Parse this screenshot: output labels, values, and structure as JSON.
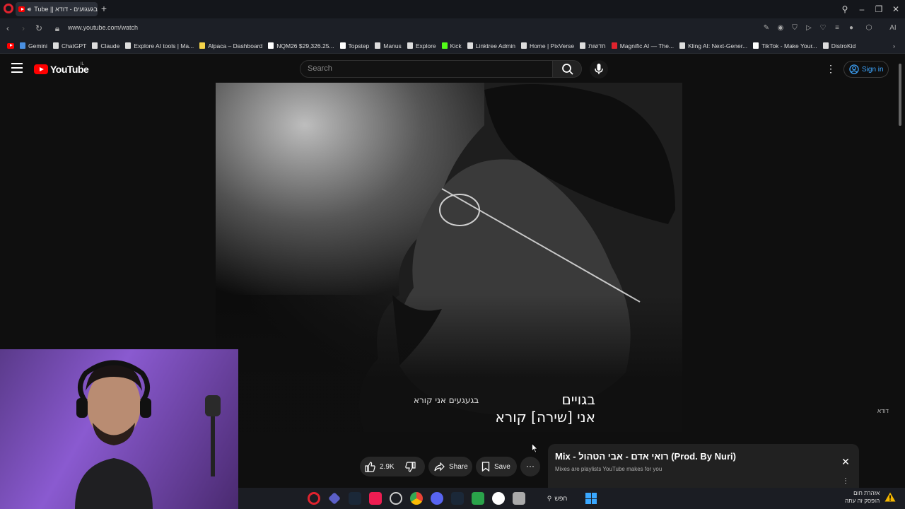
{
  "browser": {
    "tab_title": "Tube || בגעגועים - דודא",
    "url": "www.youtube.com/watch",
    "bookmarks": [
      {
        "label": "Gemini",
        "color": "#4a90e2"
      },
      {
        "label": "ChatGPT",
        "color": "#dddddd"
      },
      {
        "label": "Claude",
        "color": "#dddddd"
      },
      {
        "label": "Explore AI tools | Ma...",
        "color": "#dddddd"
      },
      {
        "label": "Alpaca – Dashboard",
        "color": "#f5d44a"
      },
      {
        "label": "NQM26 $29,326.25...",
        "color": "#ffffff"
      },
      {
        "label": "Topstep",
        "color": "#ffffff"
      },
      {
        "label": "Manus",
        "color": "#dddddd"
      },
      {
        "label": "Explore",
        "color": "#dddddd"
      },
      {
        "label": "Kick",
        "color": "#53fc18"
      },
      {
        "label": "Linktree Admin",
        "color": "#dddddd"
      },
      {
        "label": "Home | PixVerse",
        "color": "#dddddd"
      },
      {
        "label": "חדשות",
        "color": "#dddddd"
      },
      {
        "label": "Magnific AI — The...",
        "color": "#e0232e"
      },
      {
        "label": "Kling AI: Next-Gener...",
        "color": "#dddddd"
      },
      {
        "label": "TikTok - Make Your...",
        "color": "#ffffff"
      },
      {
        "label": "DistroKid",
        "color": "#dddddd"
      }
    ],
    "opera_color": "#e0232e"
  },
  "youtube": {
    "logo_text": "YouTube",
    "country_code": "IL",
    "search_placeholder": "Search",
    "signin_label": "Sign in",
    "accent_color": "#3ea6ff"
  },
  "video": {
    "lyrics_line1": "בגויים",
    "lyrics_line2": "אני [שירה] קורא",
    "lyrics_secondary": "בגעגעים אני קורא",
    "watermark": "דודא"
  },
  "actions": {
    "likes": "2.9K",
    "share_label": "Share",
    "save_label": "Save"
  },
  "mix": {
    "title": "Mix - רואי אדם - אבי הטהול (Prod. By Nuri)",
    "subtitle": "Mixes are playlists YouTube makes for you"
  },
  "taskbar": {
    "search_label": "חפש",
    "weather_line1": "אזהרת חום",
    "weather_line2": "הופסק זה עתה"
  }
}
